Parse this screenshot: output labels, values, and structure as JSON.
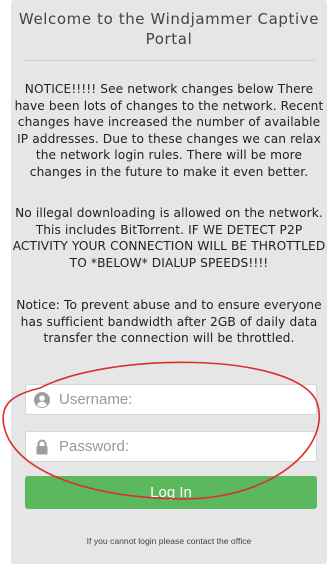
{
  "portal": {
    "title": "Welcome to the Windjammer Captive Portal"
  },
  "notices": [
    "NOTICE!!!!! See network changes below There have been lots of changes to the network. Recent changes have increased the number of available IP addresses. Due to these changes we can relax the network login rules. There will be more changes in the future to make it even better.",
    "No illegal downloading is allowed on the network. This includes BitTorrent. IF WE DETECT P2P ACTIVITY YOUR CONNECTION WILL BE THROTTLED TO *BELOW* DIALUP SPEEDS!!!!",
    "Notice: To prevent abuse and to ensure everyone has sufficient bandwidth after 2GB of daily data transfer the connection will be throttled."
  ],
  "login": {
    "username_placeholder": "Username:",
    "password_placeholder": "Password:",
    "button_label": "Log In",
    "help_text": "If you cannot login please contact the office"
  },
  "icons": {
    "username": "user-icon",
    "password": "lock-icon"
  },
  "colors": {
    "card_background": "#e6e6e6",
    "button_green": "#5cb85c",
    "annotation_red": "#d9302c"
  }
}
